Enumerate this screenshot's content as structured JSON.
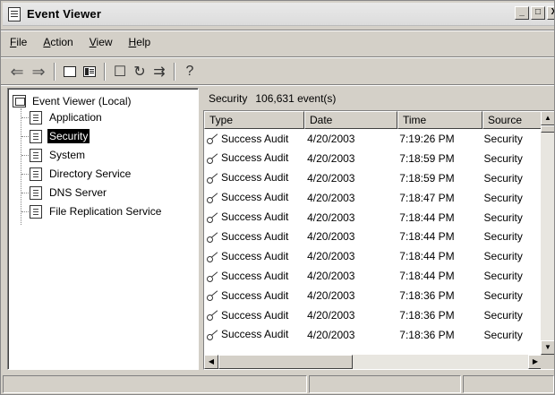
{
  "window": {
    "title": "Event Viewer",
    "buttons": [
      "_",
      "□",
      "X"
    ]
  },
  "menu": [
    {
      "underline": "F",
      "rest": "ile"
    },
    {
      "underline": "A",
      "rest": "ction"
    },
    {
      "underline": "V",
      "rest": "iew"
    },
    {
      "underline": "H",
      "rest": "elp"
    }
  ],
  "toolbar": {
    "icons": [
      "back-arrow-icon",
      "forward-arrow-icon",
      "up-folder-icon",
      "show-hide-tree-icon",
      "properties-icon",
      "refresh-icon",
      "export-list-icon",
      "help-icon"
    ]
  },
  "tree": {
    "root": "Event Viewer (Local)",
    "items": [
      {
        "label": "Application"
      },
      {
        "label": "Security",
        "selected": true
      },
      {
        "label": "System"
      },
      {
        "label": "Directory Service"
      },
      {
        "label": "DNS Server"
      },
      {
        "label": "File Replication Service"
      }
    ]
  },
  "list": {
    "log_name": "Security",
    "event_count": "106,631 event(s)",
    "columns": [
      "Type",
      "Date",
      "Time",
      "Source"
    ],
    "rows": [
      [
        "Success Audit",
        "4/20/2003",
        "7:19:26 PM",
        "Security"
      ],
      [
        "Success Audit",
        "4/20/2003",
        "7:18:59 PM",
        "Security"
      ],
      [
        "Success Audit",
        "4/20/2003",
        "7:18:59 PM",
        "Security"
      ],
      [
        "Success Audit",
        "4/20/2003",
        "7:18:47 PM",
        "Security"
      ],
      [
        "Success Audit",
        "4/20/2003",
        "7:18:44 PM",
        "Security"
      ],
      [
        "Success Audit",
        "4/20/2003",
        "7:18:44 PM",
        "Security"
      ],
      [
        "Success Audit",
        "4/20/2003",
        "7:18:44 PM",
        "Security"
      ],
      [
        "Success Audit",
        "4/20/2003",
        "7:18:44 PM",
        "Security"
      ],
      [
        "Success Audit",
        "4/20/2003",
        "7:18:36 PM",
        "Security"
      ],
      [
        "Success Audit",
        "4/20/2003",
        "7:18:36 PM",
        "Security"
      ],
      [
        "Success Audit",
        "4/20/2003",
        "7:18:36 PM",
        "Security"
      ]
    ]
  },
  "statusbar": {
    "cells": [
      "",
      "",
      ""
    ]
  }
}
